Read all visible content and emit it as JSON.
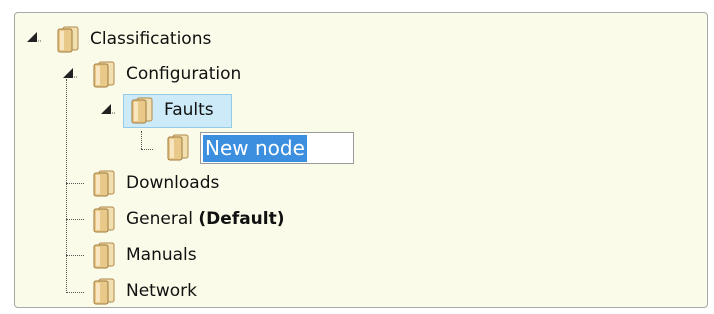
{
  "tree": {
    "root": {
      "label": "Classifications"
    },
    "configuration": {
      "label": "Configuration"
    },
    "faults": {
      "label": "Faults"
    },
    "new_node": {
      "value": "New node"
    },
    "downloads": {
      "label": "Downloads"
    },
    "general": {
      "label": "General",
      "suffix": "(Default)"
    },
    "manuals": {
      "label": "Manuals"
    },
    "network": {
      "label": "Network"
    }
  },
  "icons": {
    "folder": "folder-icon",
    "expanded": "expanded-triangle-icon"
  },
  "colors": {
    "panel_bg": "#fbfbe9",
    "selection_bg": "#cdeaf8",
    "edit_highlight": "#3c8fde"
  }
}
